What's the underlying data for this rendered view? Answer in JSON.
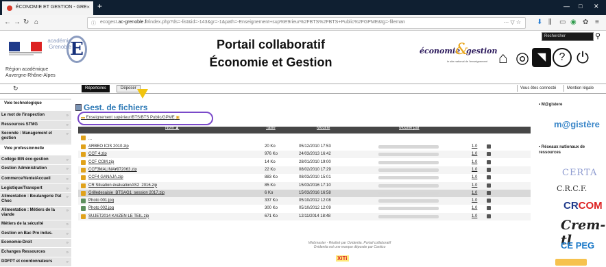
{
  "browser": {
    "tab_title": "ÉCONOMIE ET GESTION - GRE",
    "url_prefix": "ecogest.",
    "url_host": "ac-grenoble.fr",
    "url_rest": "/index.php?ds=-list&id=-143&gr=-1&path=-Enseignement+sup%E9rieur%2FBTS%2FBTS+Public%2FGPME&tg=-fileman",
    "tab_close": "×",
    "new_tab": "+"
  },
  "header": {
    "academie_word": "académie Grenoble",
    "academie_letter": "E",
    "region_line1": "Région académique",
    "region_line2": "Auvergne-Rhône-Alpes",
    "title_line1": "Portail collaboratif",
    "title_line2": "Économie et Gestion",
    "eg_logo_word": "économie",
    "eg_logo_amp": "&",
    "eg_logo_word2": "gestion",
    "eg_logo_sub": "le site national de l'enseignement",
    "search_placeholder": "Rechercher"
  },
  "menubar": {
    "tab_repertoires": "Répertoires",
    "tab_deposer": "Déposer",
    "right_link1": "Vous êtes connecté",
    "right_link2": "Mention légale"
  },
  "sidebar": {
    "items": [
      {
        "label": "Voie technologique",
        "head": true
      },
      {
        "label": "Le mot de l'inspection"
      },
      {
        "label": "Ressources STMG"
      },
      {
        "label": "Seconde : Management et gestion"
      },
      {
        "label": "Voie professionnelle",
        "head": true
      },
      {
        "label": "Collège IEN éco-gestion"
      },
      {
        "label": "Gestion Administration"
      },
      {
        "label": "Commerce/Vente/Accueil"
      },
      {
        "label": "Logistique/Transport"
      },
      {
        "label": "Alimentation : Boulangerie Pat Choc"
      },
      {
        "label": "Alimentation : Métiers de la viande"
      },
      {
        "label": "Métiers de la sécurité"
      },
      {
        "label": "Gestion en Bac Pro indus."
      },
      {
        "label": "Economie-Droit"
      },
      {
        "label": "Echanges Ressources"
      },
      {
        "label": "DDFPT et coordonnateurs"
      }
    ]
  },
  "main": {
    "heading": "Gest. de fichiers",
    "path": "Enseignement supérieur/BTS/BTS Public/GPME",
    "columns": {
      "name": "Nom ▲",
      "size": "Taille",
      "modified": "Modifié",
      "modified_by": "Modifié par"
    },
    "up_label": "...",
    "files": [
      {
        "name": "ARBEO ICIS 2010.zip",
        "size": "20 Ko",
        "date": "05/12/2010 17:53",
        "ver": "1.0",
        "kind": "zip"
      },
      {
        "name": "CCF 4.zip",
        "size": "976 Ko",
        "date": "24/03/2013 16:42",
        "ver": "1.0",
        "kind": "zip"
      },
      {
        "name": "CCF COM.zip",
        "size": "14 Ko",
        "date": "28/01/2010 19:00",
        "ver": "1.0",
        "kind": "zip"
      },
      {
        "name": "CCF3MALINA¥972063.zip",
        "size": "22 Ko",
        "date": "08/02/2010 17:29",
        "ver": "1.0",
        "kind": "zip"
      },
      {
        "name": "CCF4 GANAJA.zip",
        "size": "883 Ko",
        "date": "08/03/2010 15:01",
        "ver": "1.0",
        "kind": "zip"
      },
      {
        "name": "CR Situation évaluationAS2_2016.zip",
        "size": "85 Ko",
        "date": "15/03/2016 17:10",
        "ver": "1.0",
        "kind": "zip"
      },
      {
        "name": "Grilledesaisie_BTSAG1_session 2017.zip",
        "size": "6 Ko",
        "date": "15/03/2016 16:58",
        "ver": "1.0",
        "kind": "zip"
      },
      {
        "name": "Photo 001.jpg",
        "size": "337 Ko",
        "date": "05/10/2012 12:08",
        "ver": "1.0",
        "kind": "jpg"
      },
      {
        "name": "Photo 002.jpg",
        "size": "300 Ko",
        "date": "05/10/2012 12:09",
        "ver": "1.0",
        "kind": "jpg"
      },
      {
        "name": "SUJET2014 KAIZEN LE TEIL.zip",
        "size": "671 Ko",
        "date": "12/11/2014 18:48",
        "ver": "1.0",
        "kind": "zip"
      }
    ],
    "footer_line1": "Webmaster - Réalisé par Ovidentia. Portail collaboratif",
    "footer_line2": "Ovidentia est une marque déposée par Cantico",
    "xiti": "XiTi"
  },
  "right": {
    "sec1_title": "M@gistere",
    "magistere_logo": "m@gistère",
    "sec2_title": "Réseaux nationaux de ressources",
    "certa": "CERTA",
    "crcf": "C.R.C.F.",
    "crcom_a": "CR",
    "crcom_b": "COM",
    "cremtl": "Crem-tl",
    "ceipeg_a": "CE",
    "ceipeg_b": "PEG"
  },
  "colors": {
    "accent_blue": "#2b78b5",
    "path_outline": "#7a49c9",
    "table_header": "#474747",
    "sidebar_bg": "#e4e4e4"
  }
}
